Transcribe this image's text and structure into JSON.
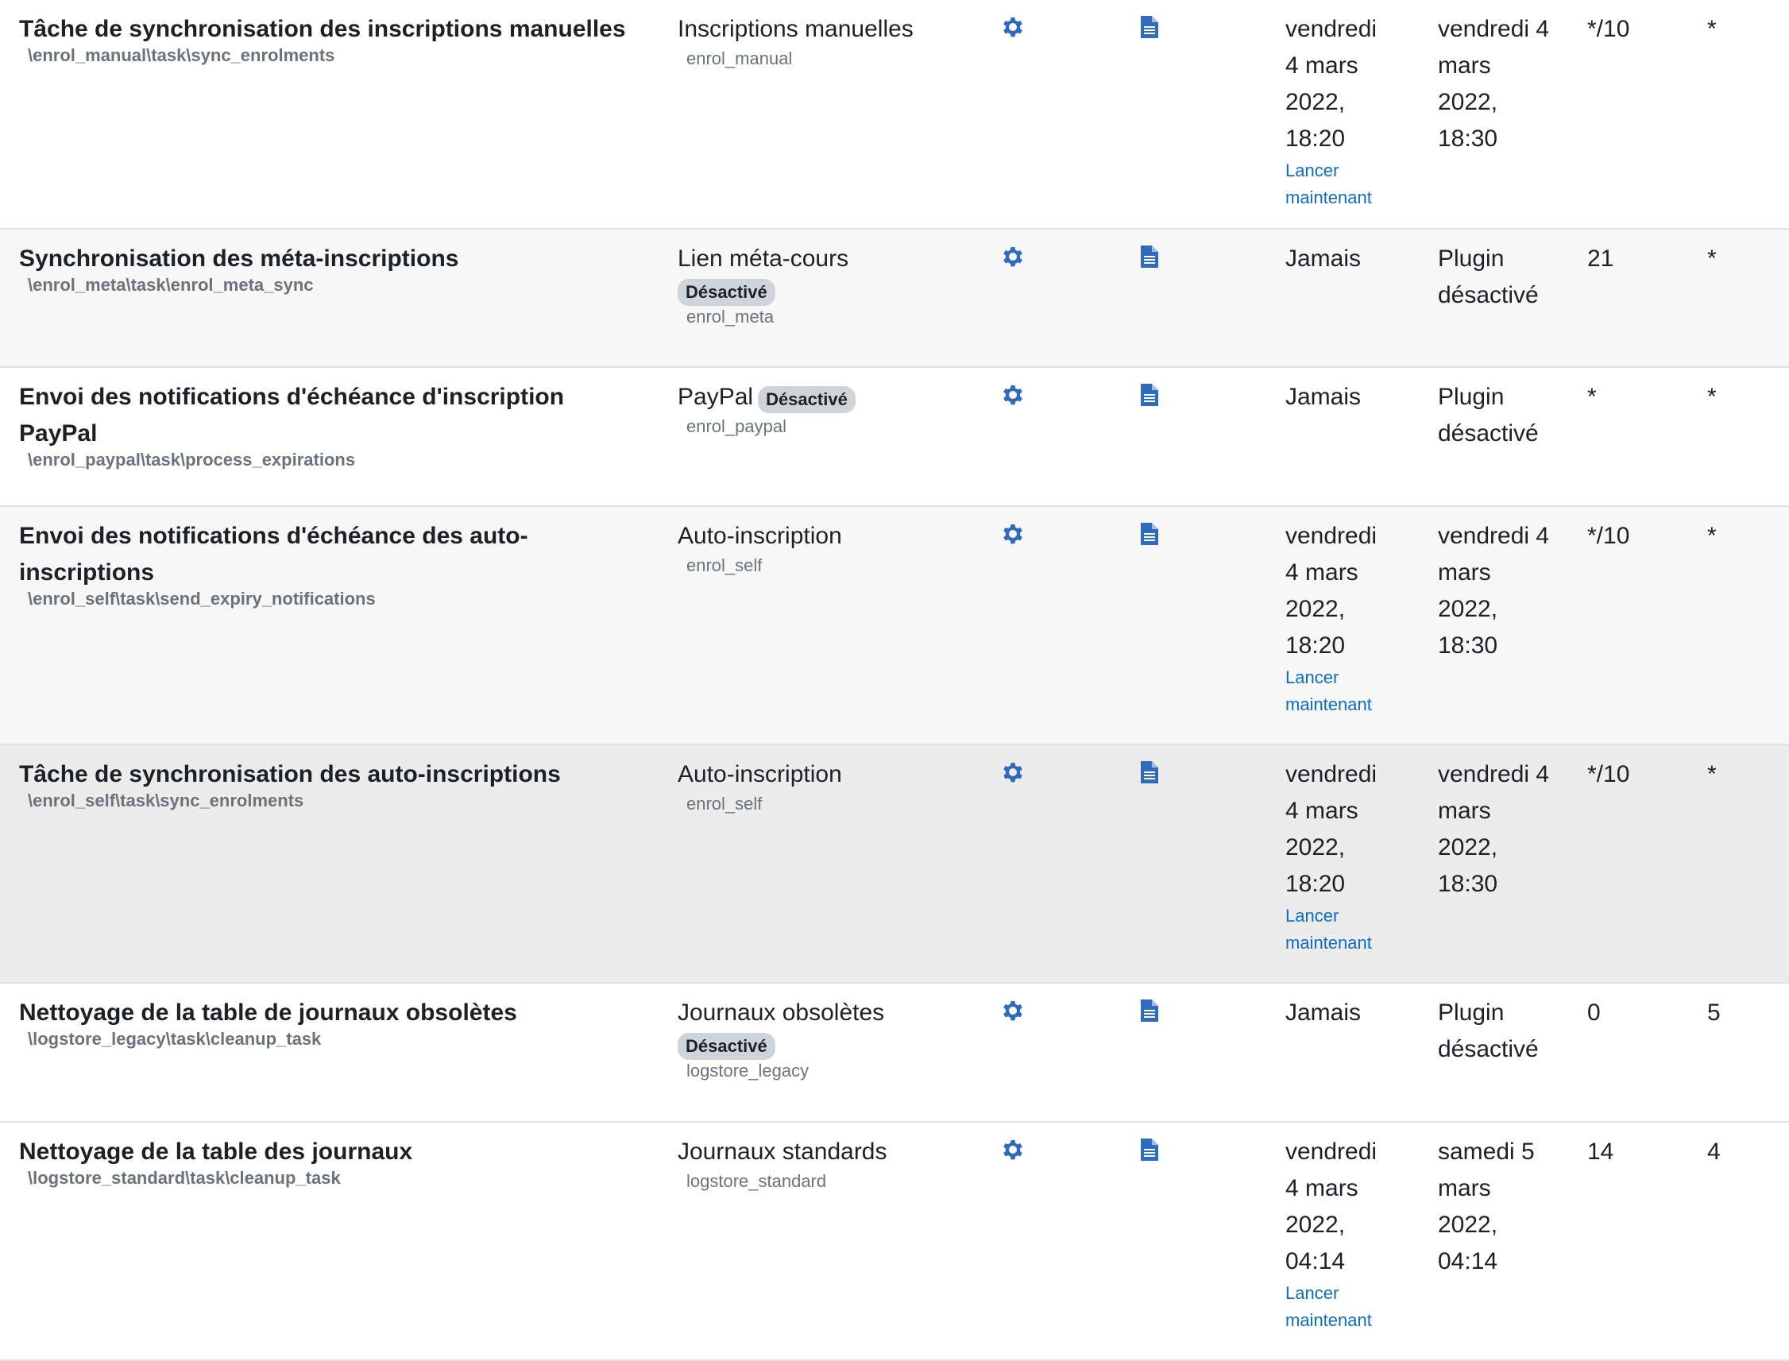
{
  "colors": {
    "icon": "#2f6bbd",
    "link": "#0f6cbf",
    "badge_bg": "#ced4da",
    "muted": "#6a737b"
  },
  "rows": [
    {
      "title": "Tâche de synchronisation des inscriptions manuelles",
      "classname": "\\enrol_manual\\task\\sync_enrolments",
      "component": "Inscriptions manuelles",
      "component_code": "enrol_manual",
      "last_run": [
        "vendredi",
        "4 mars",
        "2022,",
        "18:20"
      ],
      "run_now": [
        "Lancer",
        "maintenant"
      ],
      "next_run": [
        "vendredi 4",
        "mars",
        "2022,",
        "18:30"
      ],
      "minute": "*/10",
      "hour": "*"
    },
    {
      "title": "Synchronisation des méta-inscriptions",
      "classname": "\\enrol_meta\\task\\enrol_meta_sync",
      "component": "Lien méta-cours",
      "badge": "Désactivé",
      "component_code": "enrol_meta",
      "last_run": "Jamais",
      "next_run": [
        "Plugin",
        "désactivé"
      ],
      "minute": "21",
      "hour": "*"
    },
    {
      "title": [
        "Envoi des notifications d'échéance d'inscription",
        "PayPal"
      ],
      "classname": "\\enrol_paypal\\task\\process_expirations",
      "component": "PayPal",
      "badge": "Désactivé",
      "component_code": "enrol_paypal",
      "last_run": "Jamais",
      "next_run": [
        "Plugin",
        "désactivé"
      ],
      "minute": "*",
      "hour": "*"
    },
    {
      "title": [
        "Envoi des notifications d'échéance des auto-",
        "inscriptions"
      ],
      "classname": "\\enrol_self\\task\\send_expiry_notifications",
      "component": "Auto-inscription",
      "component_code": "enrol_self",
      "last_run": [
        "vendredi",
        "4 mars",
        "2022,",
        "18:20"
      ],
      "run_now": [
        "Lancer",
        "maintenant"
      ],
      "next_run": [
        "vendredi 4",
        "mars",
        "2022,",
        "18:30"
      ],
      "minute": "*/10",
      "hour": "*"
    },
    {
      "title": "Tâche de synchronisation des auto-inscriptions",
      "classname": "\\enrol_self\\task\\sync_enrolments",
      "component": "Auto-inscription",
      "component_code": "enrol_self",
      "last_run": [
        "vendredi",
        "4 mars",
        "2022,",
        "18:20"
      ],
      "run_now": [
        "Lancer",
        "maintenant"
      ],
      "next_run": [
        "vendredi 4",
        "mars",
        "2022,",
        "18:30"
      ],
      "minute": "*/10",
      "hour": "*"
    },
    {
      "title": "Nettoyage de la table de journaux obsolètes",
      "classname": "\\logstore_legacy\\task\\cleanup_task",
      "component": "Journaux obsolètes",
      "badge": "Désactivé",
      "component_code": "logstore_legacy",
      "last_run": "Jamais",
      "next_run": [
        "Plugin",
        "désactivé"
      ],
      "minute": "0",
      "hour": "5"
    },
    {
      "title": "Nettoyage de la table des journaux",
      "classname": "\\logstore_standard\\task\\cleanup_task",
      "component": "Journaux standards",
      "component_code": "logstore_standard",
      "last_run": [
        "vendredi",
        "4 mars",
        "2022,",
        "04:14"
      ],
      "run_now": [
        "Lancer",
        "maintenant"
      ],
      "next_run": [
        "samedi 5",
        "mars",
        "2022,",
        "04:14"
      ],
      "minute": "14",
      "hour": "4"
    }
  ]
}
